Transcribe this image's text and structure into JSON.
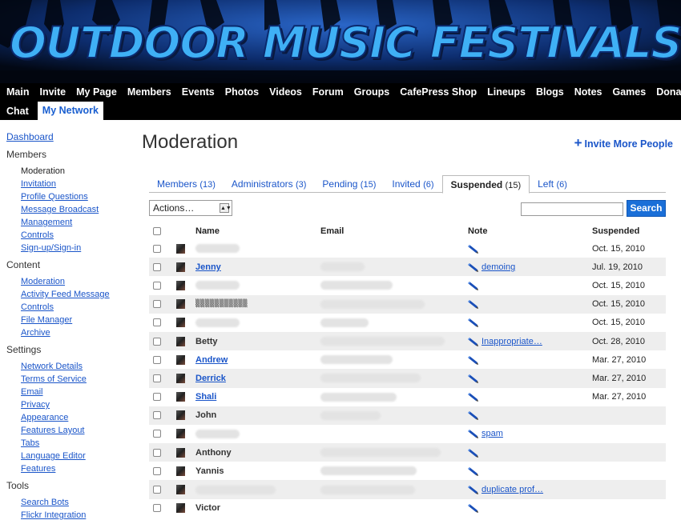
{
  "site": {
    "title": "OUTDOOR MUSIC FESTIVALS",
    "nav_row1": [
      "Main",
      "Invite",
      "My Page",
      "Members",
      "Events",
      "Photos",
      "Videos",
      "Forum",
      "Groups",
      "CafePress Shop",
      "Lineups",
      "Blogs",
      "Notes",
      "Games",
      "Donate"
    ],
    "nav_row2": [
      "Chat",
      "My Network"
    ],
    "active_nav": "My Network"
  },
  "sidebar": {
    "dashboard": "Dashboard",
    "sections": [
      {
        "title": "Members",
        "items": [
          "Moderation",
          "Invitation",
          "Profile Questions",
          "Message Broadcast",
          "Management",
          "Controls",
          "Sign-up/Sign-in"
        ],
        "current": "Moderation"
      },
      {
        "title": "Content",
        "items": [
          "Moderation",
          "Activity Feed Message",
          "Controls",
          "File Manager",
          "Archive"
        ]
      },
      {
        "title": "Settings",
        "items": [
          "Network Details",
          "Terms of Service",
          "Email",
          "Privacy",
          "Appearance",
          "Features Layout",
          "Tabs",
          "Language Editor",
          "Features"
        ]
      },
      {
        "title": "Tools",
        "items": [
          "Search Bots",
          "Flickr Integration"
        ]
      }
    ]
  },
  "main": {
    "title": "Moderation",
    "invite_more": "Invite More People",
    "tabs": [
      {
        "label": "Members",
        "count": "(13)"
      },
      {
        "label": "Administrators",
        "count": "(3)"
      },
      {
        "label": "Pending",
        "count": "(15)"
      },
      {
        "label": "Invited",
        "count": "(6)"
      },
      {
        "label": "Suspended",
        "count": "(15)",
        "active": true
      },
      {
        "label": "Left",
        "count": "(6)"
      }
    ],
    "actions_select": "Actions…",
    "search_button": "Search",
    "search_value": "",
    "columns": {
      "name": "Name",
      "email": "Email",
      "note": "Note",
      "suspended": "Suspended"
    },
    "rows": [
      {
        "name": "",
        "link": false,
        "note": "",
        "date": "Oct. 15, 2010"
      },
      {
        "name": "Jenny",
        "link": true,
        "note": "demoing",
        "date": "Jul. 19, 2010"
      },
      {
        "name": "",
        "link": false,
        "note": "",
        "date": "Oct. 15, 2010"
      },
      {
        "name": "▒▒▒▒▒▒▒▒▒▒▒",
        "link": false,
        "garbled": true,
        "note": "",
        "date": "Oct. 15, 2010"
      },
      {
        "name": "",
        "link": false,
        "note": "",
        "date": "Oct. 15, 2010"
      },
      {
        "name": "Betty",
        "link": false,
        "note": "Inappropriate…",
        "date": "Oct. 28, 2010"
      },
      {
        "name": "Andrew",
        "link": true,
        "note": "",
        "date": "Mar. 27, 2010"
      },
      {
        "name": "Derrick",
        "link": true,
        "note": "",
        "date": "Mar. 27, 2010"
      },
      {
        "name": "Shali",
        "link": true,
        "note": "",
        "date": "Mar. 27, 2010"
      },
      {
        "name": "John",
        "link": false,
        "note": "",
        "date": ""
      },
      {
        "name": "",
        "link": false,
        "note": "spam",
        "date": ""
      },
      {
        "name": "Anthony",
        "link": false,
        "note": "",
        "date": ""
      },
      {
        "name": "Yannis",
        "link": false,
        "note": "",
        "date": ""
      },
      {
        "name": "",
        "link": false,
        "note": "duplicate prof…",
        "date": ""
      },
      {
        "name": "Victor",
        "link": false,
        "note": "",
        "date": ""
      }
    ]
  },
  "colors": {
    "accent": "#1a55c9",
    "banner_title": "#3fb0f5",
    "search_button": "#1a6fd8"
  },
  "icons": {
    "invite_more": "plus-icon",
    "note": "pencil-icon",
    "actions": "dropdown-arrow-icon"
  }
}
